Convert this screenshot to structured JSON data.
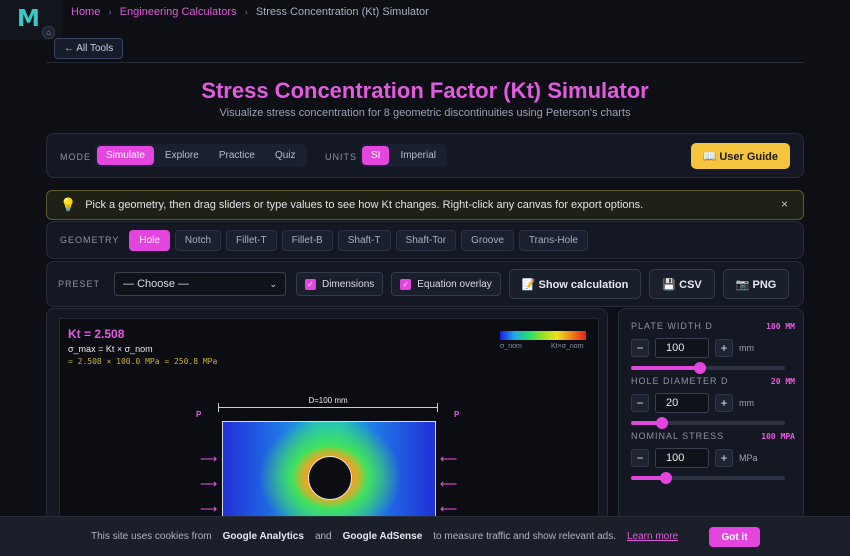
{
  "breadcrumb": {
    "home": "Home",
    "section": "Engineering Calculators",
    "sep": "›",
    "current": "Stress Concentration (Kt) Simulator"
  },
  "back_button": "← All Tools",
  "page": {
    "title": "Stress Concentration Factor (Kt) Simulator",
    "subtitle": "Visualize stress concentration for 8 geometric discontinuities using Peterson's charts"
  },
  "mode": {
    "label": "MODE",
    "options": [
      "Simulate",
      "Explore",
      "Practice",
      "Quiz"
    ],
    "active": "Simulate"
  },
  "units": {
    "label": "UNITS",
    "options": [
      "SI",
      "Imperial"
    ],
    "active": "SI"
  },
  "user_guide": "📖 User Guide",
  "tip": {
    "text": "Pick a geometry, then drag sliders or type values to see how Kt changes. Right-click any canvas for export options.",
    "close": "×"
  },
  "geometry": {
    "label": "GEOMETRY",
    "options": [
      "Hole",
      "Notch",
      "Fillet-T",
      "Fillet-B",
      "Shaft-T",
      "Shaft-Tor",
      "Groove",
      "Trans-Hole"
    ],
    "active": "Hole"
  },
  "preset": {
    "label": "PRESET",
    "value": "— Choose —"
  },
  "toggles": {
    "dimensions": "Dimensions",
    "equation_overlay": "Equation overlay"
  },
  "actions": {
    "show_calc": "📝 Show calculation",
    "csv": "💾 CSV",
    "png": "📷 PNG"
  },
  "canvas": {
    "kt_label": "Kt = 2.508",
    "formula": "σ_max = Kt × σ_nom",
    "calc": "= 2.508 × 100.0 MPa = 250.8 MPa",
    "legend_min": "σ_nom",
    "legend_max": "Kt×σ_nom",
    "dim_label": "D=100 mm",
    "load_left": "P",
    "load_right": "P"
  },
  "controls": [
    {
      "label": "PLATE WIDTH D",
      "badge": "100 MM",
      "value": "100",
      "unit": "mm",
      "fraction": 0.45
    },
    {
      "label": "HOLE DIAMETER D",
      "badge": "20 MM",
      "value": "20",
      "unit": "mm",
      "fraction": 0.2
    },
    {
      "label": "NOMINAL STRESS",
      "badge": "100 MPA",
      "value": "100",
      "unit": "MPa",
      "fraction": 0.23
    }
  ],
  "cookie": {
    "text1": "This site uses cookies from",
    "ga": "Google Analytics",
    "and": "and",
    "ads": "Google AdSense",
    "text2": "to measure traffic and show relevant ads.",
    "learn": "Learn more",
    "got_it": "Got it"
  }
}
